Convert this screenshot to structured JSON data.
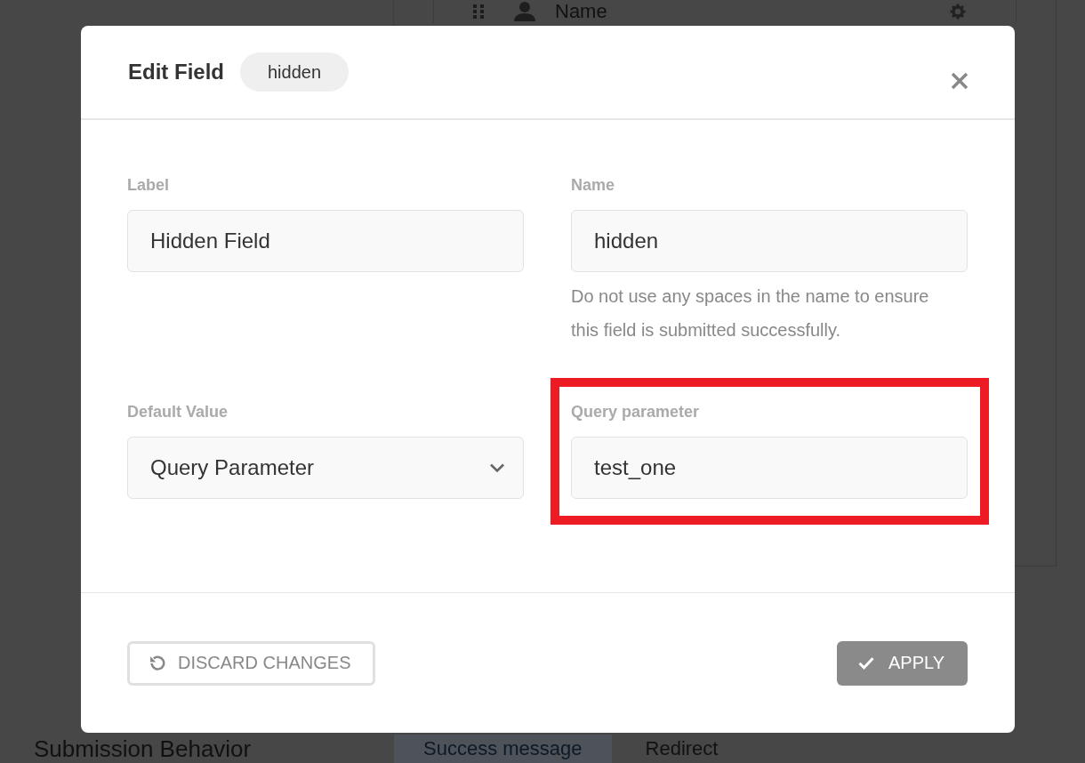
{
  "background_page": {
    "field_row": {
      "label": "Name"
    },
    "section_title": "Submission Behavior",
    "tabs": [
      {
        "label": "Success message",
        "selected": true
      },
      {
        "label": "Redirect",
        "selected": false
      }
    ]
  },
  "dialog": {
    "title": "Edit Field",
    "type_badge": "hidden",
    "fields": [
      {
        "kind": "text",
        "label": "Label",
        "value": "Hidden Field",
        "highlighted": false
      },
      {
        "kind": "text",
        "label": "Name",
        "value": "hidden",
        "help": "Do not use any spaces in the name to ensure this field is submitted successfully.",
        "highlighted": false
      },
      {
        "kind": "select",
        "label": "Default Value",
        "value": "Query Parameter",
        "highlighted": false
      },
      {
        "kind": "text",
        "label": "Query parameter",
        "value": "test_one",
        "highlighted": true
      }
    ],
    "buttons": [
      {
        "kind": "secondary",
        "label": "DISCARD CHANGES"
      },
      {
        "kind": "primary",
        "label": "APPLY"
      }
    ]
  }
}
